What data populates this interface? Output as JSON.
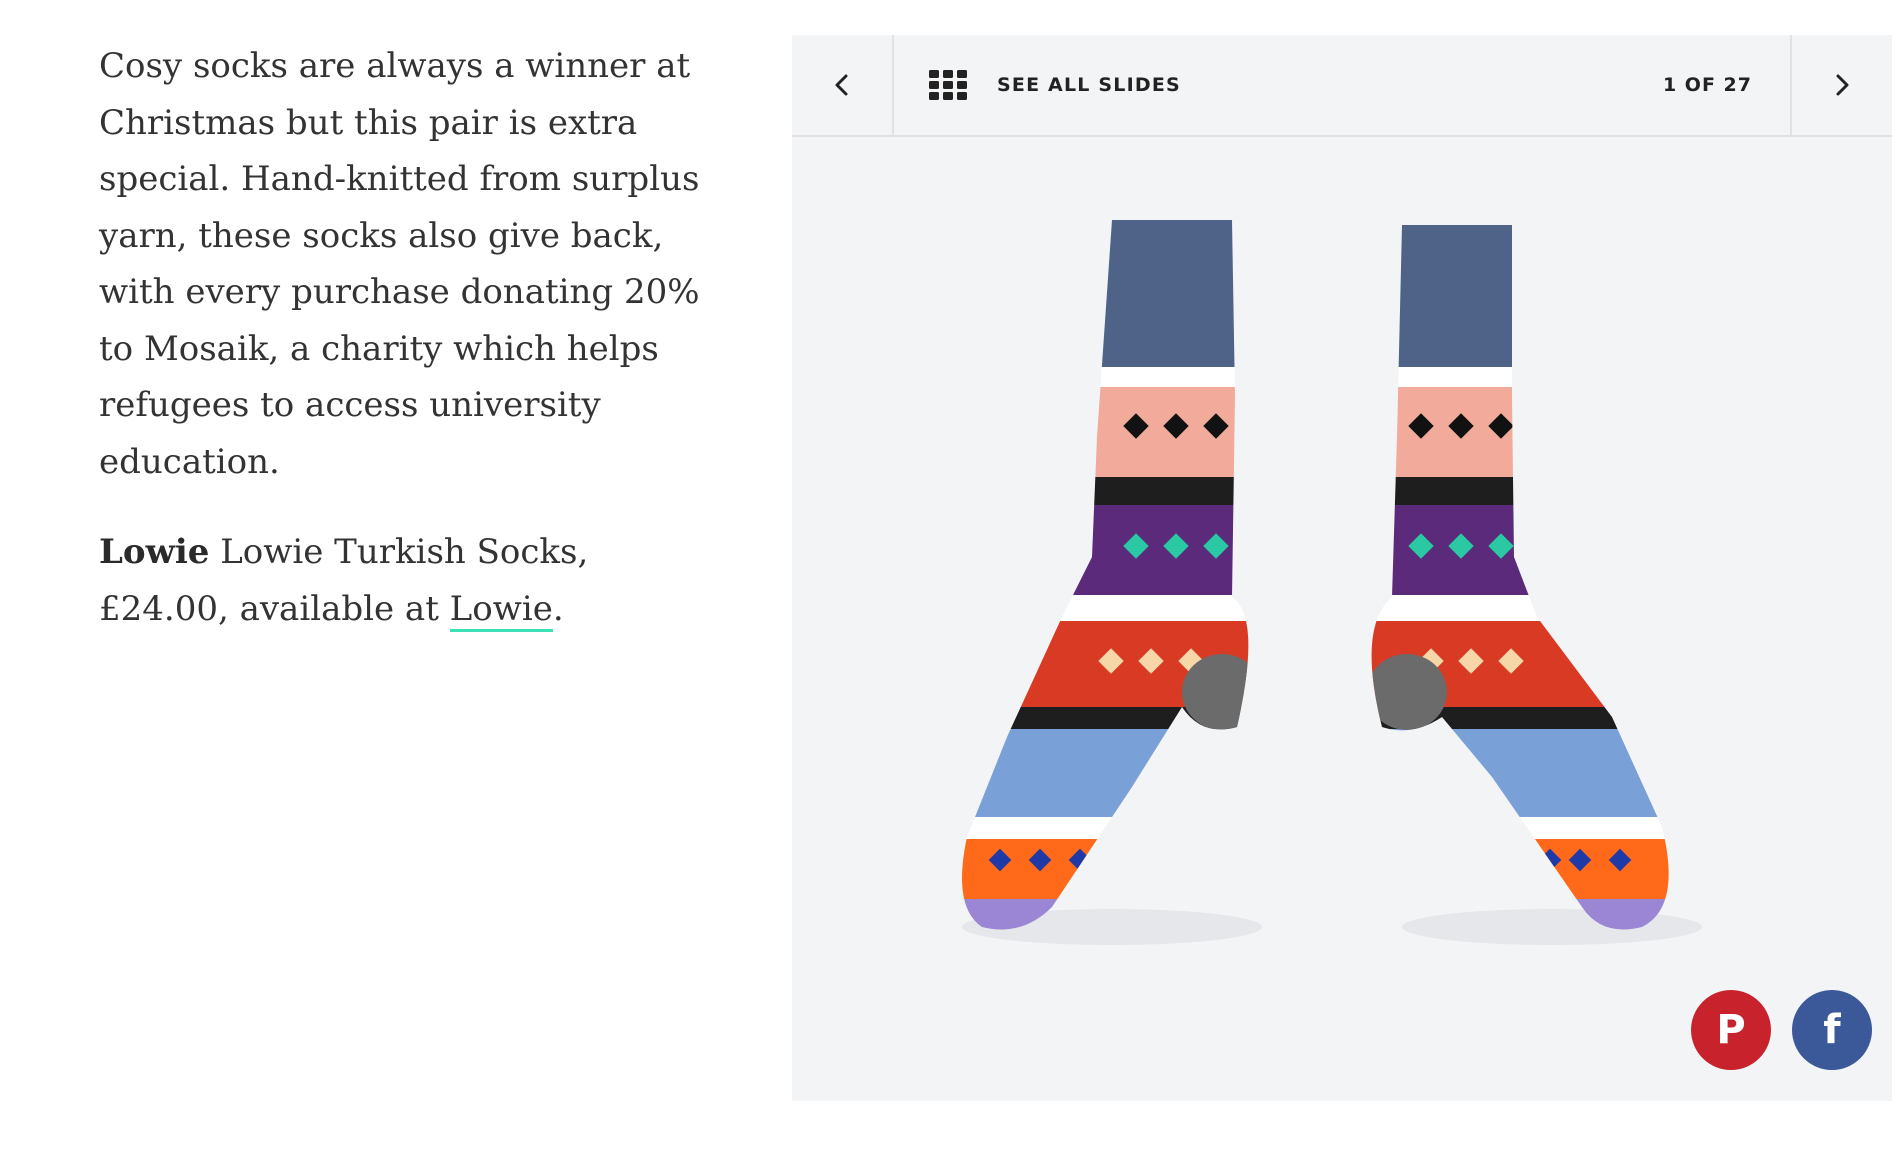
{
  "article": {
    "paragraph": "Cosy socks are always a winner at Christmas but this pair is extra special. Hand-knitted from surplus yarn, these socks also give back, with every purchase donating 20% to Mosaik, a charity which helps refugees to access university education.",
    "product": {
      "brand": "Lowie",
      "description": " Lowie Turkish Socks, £24.00, available at ",
      "link_text": "Lowie",
      "end": "."
    }
  },
  "slideshow": {
    "see_all_label": "SEE ALL SLIDES",
    "counter": "1 OF 27",
    "image_alt": "Hand-knitted Lowie Turkish Socks"
  },
  "share": {
    "pinterest_glyph": "P",
    "facebook_glyph": "f"
  },
  "colors": {
    "link_underline": "#3be0b5",
    "pinterest": "#c8232c",
    "facebook": "#3b5998"
  }
}
